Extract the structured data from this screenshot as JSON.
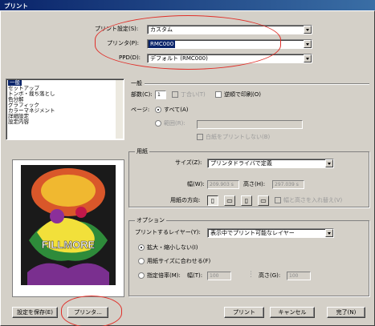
{
  "window": {
    "title": "プリント"
  },
  "top": {
    "print_setting_label": "プリント設定(S):",
    "print_setting_value": "カスタム",
    "printer_label": "プリンタ(P):",
    "printer_value": "RMC000",
    "ppd_label": "PPD(D):",
    "ppd_value": "デフォルト (RMC000)"
  },
  "categories": [
    "一般",
    "セットアップ",
    "トンボ・裁ち落とし",
    "色分解",
    "グラフィック",
    "カラーマネジメント",
    "詳細設定",
    "設定内容"
  ],
  "general": {
    "title": "一般",
    "copies_label": "部数(C):",
    "copies_value": "1",
    "collate_label": "丁合い(T)",
    "reverse_label": "逆順で印刷(O)",
    "pages_label": "ページ:",
    "all_label": "すべて(A)",
    "range_label": "範囲(R):",
    "skip_blank_label": "白紙をプリントしない(B)"
  },
  "paper": {
    "title": "用紙",
    "size_label": "サイズ(Z):",
    "size_value": "プリンタドライバで定義",
    "width_label": "幅(W):",
    "width_value": "209.903 s",
    "height_label": "高さ(H):",
    "height_value": "297.039 s",
    "orientation_label": "用紙の方向:",
    "swap_label": "幅と高さを入れ替え(V)"
  },
  "options": {
    "title": "オプション",
    "layers_label": "プリントするレイヤー(Y):",
    "layers_value": "表示中でプリント可能なレイヤー",
    "no_scale_label": "拡大・縮小しない(I)",
    "fit_label": "用紙サイズに合わせる(F)",
    "custom_scale_label": "指定倍率(M):",
    "scale_w_label": "幅(T):",
    "scale_w_value": "100",
    "scale_h_label": "高さ(G):",
    "scale_h_value": "100"
  },
  "buttons": {
    "save": "設定を保存(E)",
    "printer": "プリンタ...",
    "print": "プリント",
    "cancel": "キャンセル",
    "done": "完了(N)"
  },
  "preview": {
    "headline": "FILLMORE"
  },
  "colors": {
    "title_bar": "#0a246a",
    "highlight": "#0a246a",
    "annotation": "#e0302a"
  }
}
